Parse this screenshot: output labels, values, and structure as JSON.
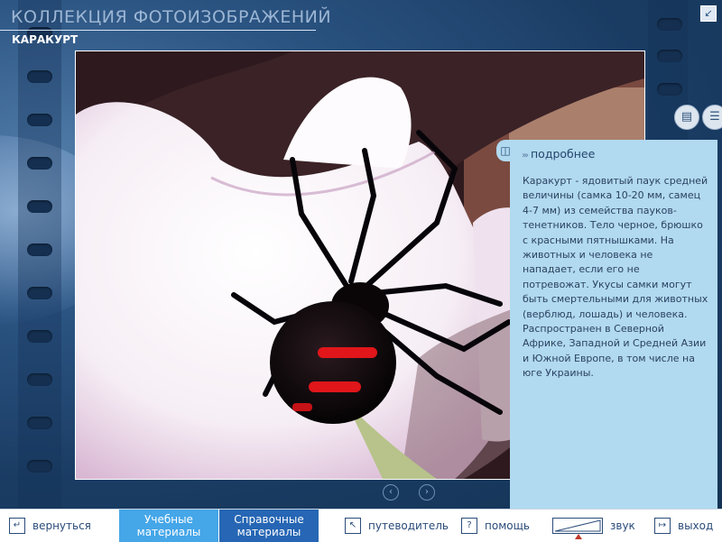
{
  "header": {
    "title": "КОЛЛЕКЦИЯ ФОТОИЗОБРАЖЕНИЙ",
    "subtitle": "КАРАКУРТ"
  },
  "details": {
    "title": "подробнее",
    "text": "Каракурт - ядовитый паук средней величины (самка 10-20 мм, самец 4-7 мм) из семейства пауков-тенетников. Тело черное, брюшко с красными пятнышками. На животных и человека не нападает, если его не потревожат. Укусы самки могут быть смертельными для животных (верблюд, лошадь) и человека. Распространен в Северной Африке, Западной и Средней Азии и Южной Европе, в том числе на юге Украины."
  },
  "bottom_bar": {
    "back": "вернуться",
    "tab1": "Учебные материалы",
    "tab2": "Справочные материалы",
    "guide": "путеводитель",
    "help": "помощь",
    "sound": "звук",
    "exit": "выход"
  },
  "colors": {
    "panel": "#b1d9ef",
    "tab_active": "#45a6e8",
    "tab_selected": "#2666b4",
    "background": "#1d3e64"
  }
}
